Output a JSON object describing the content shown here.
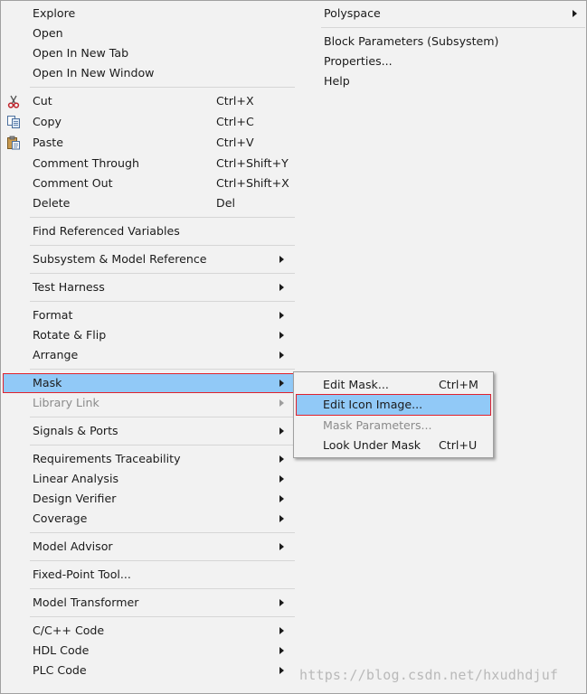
{
  "left_column": [
    {
      "label": "Explore",
      "shortcut": "",
      "submenu": false,
      "disabled": false
    },
    {
      "label": "Open",
      "shortcut": "",
      "submenu": false,
      "disabled": false
    },
    {
      "label": "Open In New Tab",
      "shortcut": "",
      "submenu": false,
      "disabled": false
    },
    {
      "label": "Open In New Window",
      "shortcut": "",
      "submenu": false,
      "disabled": false
    },
    {
      "label": "Cut",
      "shortcut": "Ctrl+X",
      "submenu": false,
      "disabled": false,
      "icon": "scissors-icon"
    },
    {
      "label": "Copy",
      "shortcut": "Ctrl+C",
      "submenu": false,
      "disabled": false,
      "icon": "copy-icon"
    },
    {
      "label": "Paste",
      "shortcut": "Ctrl+V",
      "submenu": false,
      "disabled": false,
      "icon": "clipboard-icon"
    },
    {
      "label": "Comment Through",
      "shortcut": "Ctrl+Shift+Y",
      "submenu": false,
      "disabled": false
    },
    {
      "label": "Comment Out",
      "shortcut": "Ctrl+Shift+X",
      "submenu": false,
      "disabled": false
    },
    {
      "label": "Delete",
      "shortcut": "Del",
      "submenu": false,
      "disabled": false
    },
    {
      "label": "Find Referenced Variables",
      "shortcut": "",
      "submenu": false,
      "disabled": false
    },
    {
      "label": "Subsystem & Model Reference",
      "shortcut": "",
      "submenu": true,
      "disabled": false
    },
    {
      "label": "Test Harness",
      "shortcut": "",
      "submenu": true,
      "disabled": false
    },
    {
      "label": "Format",
      "shortcut": "",
      "submenu": true,
      "disabled": false
    },
    {
      "label": "Rotate & Flip",
      "shortcut": "",
      "submenu": true,
      "disabled": false
    },
    {
      "label": "Arrange",
      "shortcut": "",
      "submenu": true,
      "disabled": false
    },
    {
      "label": "Mask",
      "shortcut": "",
      "submenu": true,
      "disabled": false,
      "selected": true
    },
    {
      "label": "Library Link",
      "shortcut": "",
      "submenu": true,
      "disabled": true
    },
    {
      "label": "Signals & Ports",
      "shortcut": "",
      "submenu": true,
      "disabled": false
    },
    {
      "label": "Requirements Traceability",
      "shortcut": "",
      "submenu": true,
      "disabled": false
    },
    {
      "label": "Linear Analysis",
      "shortcut": "",
      "submenu": true,
      "disabled": false
    },
    {
      "label": "Design Verifier",
      "shortcut": "",
      "submenu": true,
      "disabled": false
    },
    {
      "label": "Coverage",
      "shortcut": "",
      "submenu": true,
      "disabled": false
    },
    {
      "label": "Model Advisor",
      "shortcut": "",
      "submenu": true,
      "disabled": false
    },
    {
      "label": "Fixed-Point Tool...",
      "shortcut": "",
      "submenu": false,
      "disabled": false
    },
    {
      "label": "Model Transformer",
      "shortcut": "",
      "submenu": true,
      "disabled": false
    },
    {
      "label": "C/C++ Code",
      "shortcut": "",
      "submenu": true,
      "disabled": false
    },
    {
      "label": "HDL Code",
      "shortcut": "",
      "submenu": true,
      "disabled": false
    },
    {
      "label": "PLC Code",
      "shortcut": "",
      "submenu": true,
      "disabled": false
    }
  ],
  "right_column": [
    {
      "label": "Polyspace",
      "submenu": true
    },
    {
      "label": "Block Parameters (Subsystem)",
      "submenu": false
    },
    {
      "label": "Properties...",
      "submenu": false
    },
    {
      "label": "Help",
      "submenu": false
    }
  ],
  "mask_submenu": [
    {
      "label": "Edit Mask...",
      "shortcut": "Ctrl+M",
      "disabled": false
    },
    {
      "label": "Edit Icon Image...",
      "shortcut": "",
      "disabled": false,
      "selected": true
    },
    {
      "label": "Mask Parameters...",
      "shortcut": "",
      "disabled": true
    },
    {
      "label": "Look Under Mask",
      "shortcut": "Ctrl+U",
      "disabled": false
    }
  ],
  "watermark": "https://blog.csdn.net/hxudhdjuf",
  "colors": {
    "menu_background": "#f2f2f2",
    "selection": "#91c9f7",
    "annotation_border": "#e0222d",
    "disabled_text": "#8b8b8b"
  }
}
